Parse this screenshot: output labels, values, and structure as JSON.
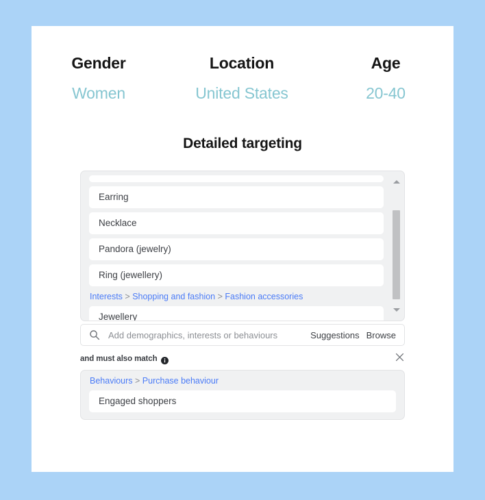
{
  "theme": {
    "page_background": "#abd3f7",
    "card_background": "#ffffff",
    "accent_teal": "#86c6d1",
    "link_blue": "#4a7bf7",
    "text_dark": "#151515"
  },
  "summary": {
    "columns": [
      {
        "label": "Gender",
        "value": "Women"
      },
      {
        "label": "Location",
        "value": "United States"
      },
      {
        "label": "Age",
        "value": "20-40"
      }
    ]
  },
  "targeting": {
    "title": "Detailed targeting",
    "list": {
      "items": [
        {
          "type": "row",
          "label": "Earring"
        },
        {
          "type": "row",
          "label": "Necklace"
        },
        {
          "type": "row",
          "label": "Pandora (jewelry)"
        },
        {
          "type": "row",
          "label": "Ring (jewellery)"
        },
        {
          "type": "breadcrumb",
          "parts": [
            "Interests",
            "Shopping and fashion",
            "Fashion accessories"
          ],
          "label": "Interests > Shopping and fashion > Fashion accessories"
        },
        {
          "type": "row",
          "label": "Jewellery"
        }
      ],
      "scrollbar": {
        "up_icon": "triangle-up-icon",
        "down_icon": "triangle-down-icon"
      }
    },
    "search": {
      "icon": "search-icon",
      "placeholder": "Add demographics, interests or behaviours",
      "value": "",
      "suggestions_label": "Suggestions",
      "browse_label": "Browse"
    },
    "must_also_match": {
      "label": "and must also match",
      "info_icon": "info-icon",
      "close_icon": "close-icon",
      "items": [
        {
          "type": "breadcrumb",
          "parts": [
            "Behaviours",
            "Purchase behaviour"
          ],
          "label": "Behaviours > Purchase behaviour"
        },
        {
          "type": "row",
          "label": "Engaged shoppers"
        }
      ]
    }
  }
}
